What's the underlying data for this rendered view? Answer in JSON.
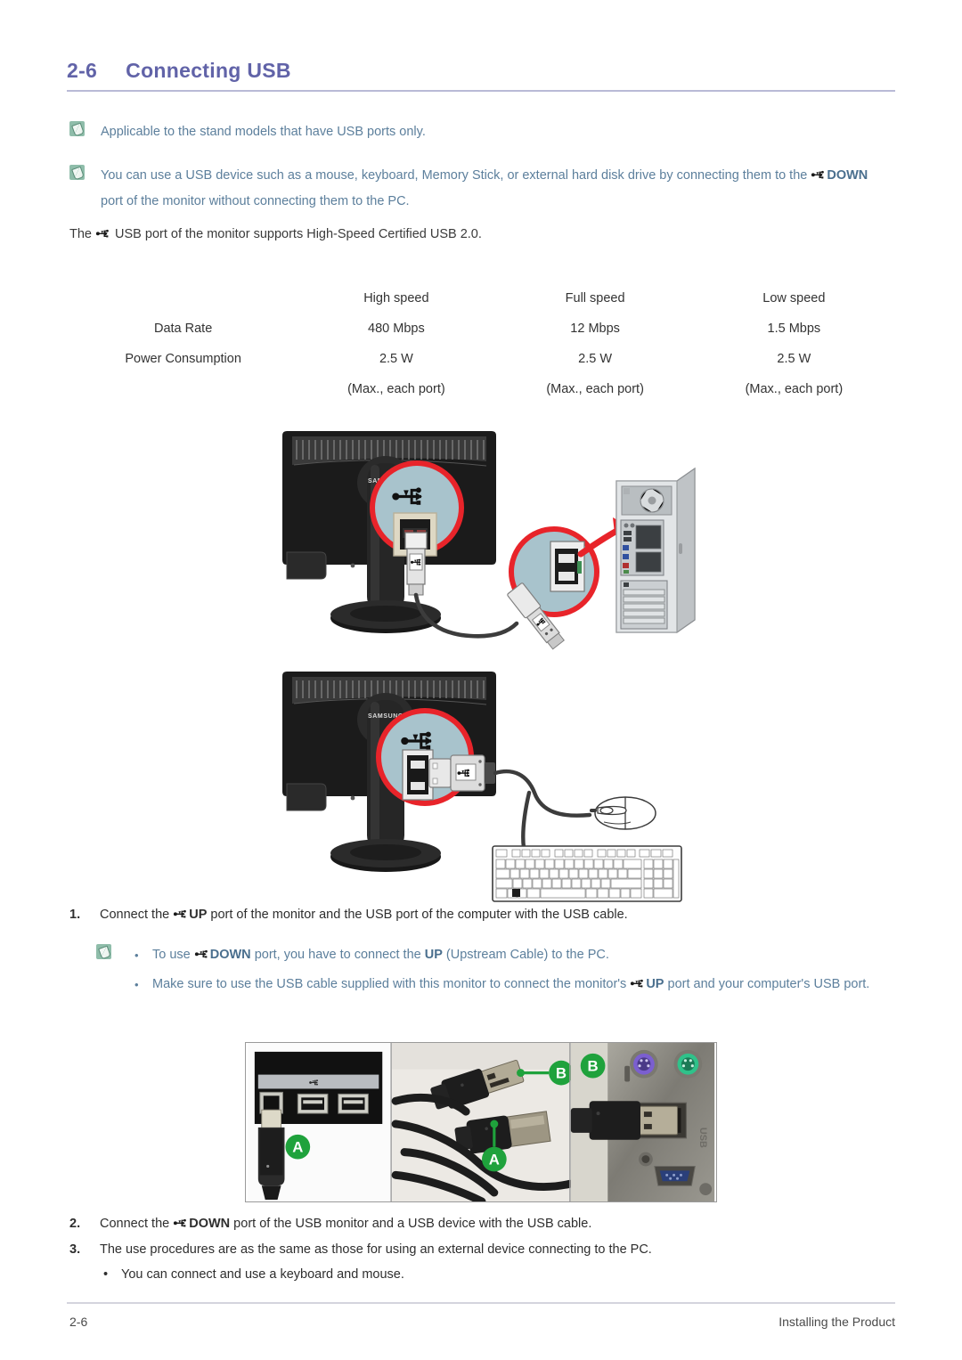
{
  "heading": {
    "number": "2-6",
    "title": "Connecting USB"
  },
  "notes": {
    "note1": "Applicable to the stand models that have USB ports only.",
    "note2_part1": "You can use a USB device such as a mouse, keyboard, Memory Stick, or external hard disk drive by connecting them to the ",
    "note2_strong": "DOWN",
    "note2_part2": " port of the monitor without connecting them to the PC.",
    "intro_part1": "The ",
    "intro_part2": " USB port of the monitor supports High-Speed Certified USB 2.0."
  },
  "spec_table": {
    "columns": [
      "High speed",
      "Full speed",
      "Low speed"
    ],
    "rows": [
      {
        "label": "",
        "values": [
          "High speed",
          "Full speed",
          "Low speed"
        ]
      },
      {
        "label": "Data Rate",
        "values": [
          "480 Mbps",
          "12 Mbps",
          "1.5 Mbps"
        ]
      },
      {
        "label": "Power Consumption",
        "values": [
          "2.5 W",
          "2.5 W",
          "2.5 W"
        ]
      },
      {
        "label": "",
        "values": [
          "(Max., each port)",
          "(Max., each port)",
          "(Max., each port)"
        ]
      }
    ]
  },
  "figures": {
    "figure1": {
      "caption": "Monitor rear USB UP port connected to PC tower USB port with USB cable",
      "brand": "SAMSUNG"
    },
    "figure2": {
      "caption": "Monitor rear USB DOWN port connected to mouse and keyboard",
      "brand": "SAMSUNG"
    },
    "photo": {
      "caption": "Photos of USB cable connector A and B ends",
      "labels": [
        "A",
        "B",
        "A",
        "B"
      ],
      "port_text": "USB"
    }
  },
  "steps": {
    "step1": {
      "number": "1.",
      "part1": "Connect the ",
      "strong": "UP",
      "part2": " port of the monitor and the USB port of the computer with the USB cable."
    },
    "step1_notes": [
      {
        "part1": "To use ",
        "strong1": "DOWN",
        "part2": " port, you have to connect the ",
        "strong2": "UP",
        "part3": " (Upstream Cable) to the PC."
      },
      {
        "part1": "Make sure to use the USB cable supplied with this monitor to connect the monitor's ",
        "strong1": "UP",
        "part2": " port and your computer's USB port."
      }
    ],
    "step2": {
      "number": "2.",
      "part1": "Connect the ",
      "strong": "DOWN",
      "part2": " port of the USB monitor and a USB device with the USB cable."
    },
    "step3": {
      "number": "3.",
      "text": "The use procedures are as the same as those for using an external device connecting to the PC."
    },
    "step3_bullet": "You can connect and use a keyboard and mouse."
  },
  "footer": {
    "page": "2-6",
    "section": "Installing the Product"
  },
  "colors": {
    "heading": "#6163a8",
    "note_text": "#5c7f9c",
    "note_icon_bg": "#8fbdaa",
    "callout_red": "#e8242a",
    "callout_fill": "#a8c3cc",
    "marker_green": "#1fa23c",
    "rule": "#b9bad6"
  }
}
